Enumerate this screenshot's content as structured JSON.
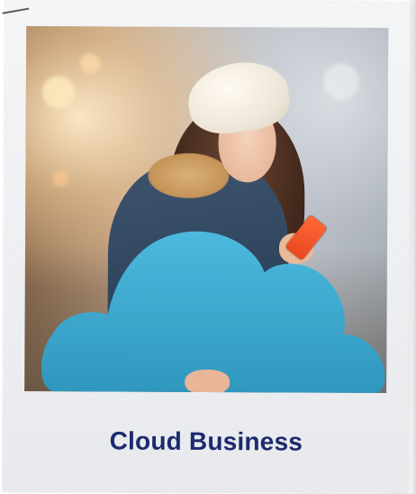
{
  "card": {
    "caption": "Cloud Business"
  },
  "photo": {
    "icon": "cloud-shape-icon"
  },
  "colors": {
    "caption_text": "#1c2a6e",
    "cloud_fill": "#3aa7cc",
    "phone": "#f15a2b",
    "frame": "#f3f4f6"
  }
}
